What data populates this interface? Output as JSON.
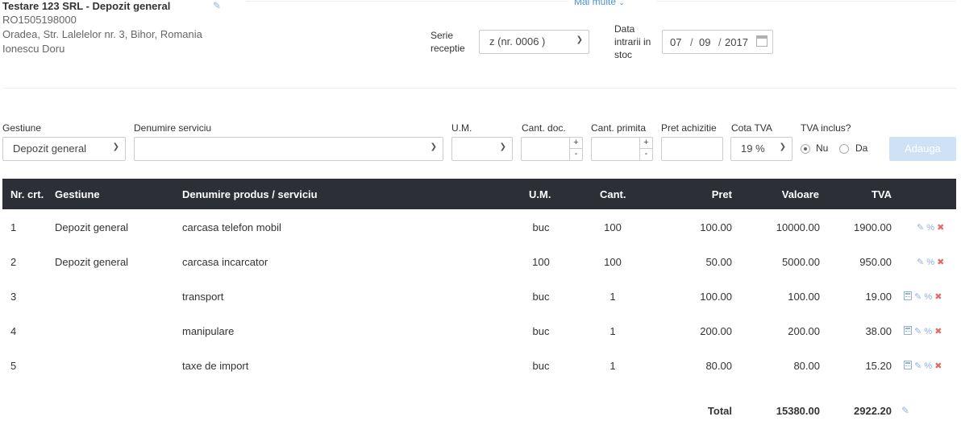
{
  "company": {
    "name": "Testare 123 SRL - Depozit general",
    "cui": "RO1505198000",
    "address": "Oradea, Str. Lalelelor nr. 3, Bihor, Romania",
    "person": "Ionescu Doru"
  },
  "more_link": "Mai multe",
  "receipt": {
    "serie_label_1": "Serie",
    "serie_label_2": "receptie",
    "serie_value": "z (nr. 0006 )",
    "date_label_1": "Data",
    "date_label_2": "intrarii in",
    "date_label_3": "stoc",
    "date_day": "07",
    "date_month": "09",
    "date_year": "2017",
    "sep": "/"
  },
  "form": {
    "gestiune_label": "Gestiune",
    "gestiune_value": "Depozit general",
    "denumire_label": "Denumire serviciu",
    "denumire_value": "",
    "um_label": "U.M.",
    "um_value": "",
    "cant_doc_label": "Cant. doc.",
    "cant_primita_label": "Cant. primita",
    "pret_label": "Pret achizitie",
    "cota_label": "Cota TVA",
    "cota_value": "19 %",
    "tva_inclus_label": "TVA inclus?",
    "radio_nu": "Nu",
    "radio_da": "Da",
    "plus": "+",
    "minus": "-",
    "add_button": "Adauga"
  },
  "table": {
    "headers": [
      "Nr. crt.",
      "Gestiune",
      "Denumire produs / serviciu",
      "U.M.",
      "Cant.",
      "Pret",
      "Valoare",
      "TVA"
    ],
    "rows": [
      {
        "nr": "1",
        "gestiune": "Depozit general",
        "denumire": "carcasa telefon mobil",
        "um": "buc",
        "cant": "100",
        "pret": "100.00",
        "valoare": "10000.00",
        "tva": "1900.00",
        "calc": false
      },
      {
        "nr": "2",
        "gestiune": "Depozit general",
        "denumire": "carcasa incarcator",
        "um": "100",
        "cant": "100",
        "pret": "50.00",
        "valoare": "5000.00",
        "tva": "950.00",
        "calc": false
      },
      {
        "nr": "3",
        "gestiune": "",
        "denumire": "transport",
        "um": "buc",
        "cant": "1",
        "pret": "100.00",
        "valoare": "100.00",
        "tva": "19.00",
        "calc": true
      },
      {
        "nr": "4",
        "gestiune": "",
        "denumire": "manipulare",
        "um": "buc",
        "cant": "1",
        "pret": "200.00",
        "valoare": "200.00",
        "tva": "38.00",
        "calc": true
      },
      {
        "nr": "5",
        "gestiune": "",
        "denumire": "taxe de import",
        "um": "buc",
        "cant": "1",
        "pret": "80.00",
        "valoare": "80.00",
        "tva": "15.20",
        "calc": true
      }
    ],
    "icon_pct": "%",
    "icon_x": "✖",
    "icon_pencil": "✎"
  },
  "totals": {
    "label": "Total",
    "valoare": "15380.00",
    "tva": "2922.20"
  },
  "colors": {
    "header_bg": "#2c2f36",
    "accent": "#4a90d9",
    "add_button_bg": "#cfe1f5",
    "delete_red": "#e26b6b"
  }
}
